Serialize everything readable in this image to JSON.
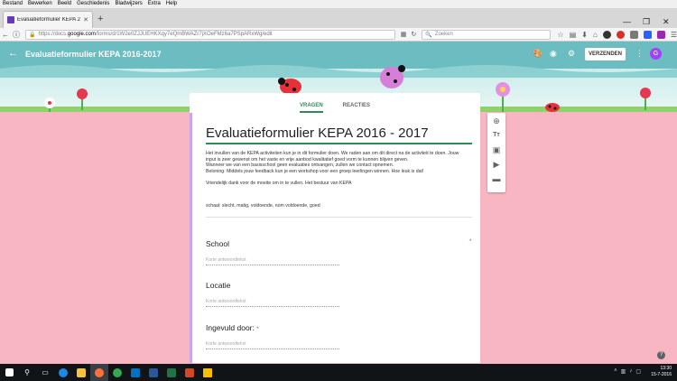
{
  "menubar": [
    "Bestand",
    "Bewerken",
    "Beeld",
    "Geschiedenis",
    "Bladwijzers",
    "Extra",
    "Help"
  ],
  "browser": {
    "tab_title": "Evaluatieformulier KEPA 20...",
    "url_prefix": "https://docs.",
    "url_host": "google.com",
    "url_rest": "/forms/d/1W2e0ZJJUEHKXqy7eQmBWAZr7jXOeFMz6a7PSpARxWg/edit",
    "search_placeholder": "Zoeken"
  },
  "forms_header": {
    "title": "Evaluatieformulier KEPA 2016-2017",
    "send_label": "VERZENDEN",
    "avatar_letter": "G"
  },
  "tabs": {
    "questions": "VRAGEN",
    "responses": "REACTIES"
  },
  "form": {
    "title": "Evaluatieformulier KEPA 2016 - 2017",
    "description": {
      "line1": "Het invullen van de KEPA activiteiten kun je in dit formulier doen. We raden aan om dit direct na de activiteit te doen. Jouw",
      "line2": "input is zeer gewenst om het vaste en vrije aanbod kwalitatief goed vorm te kunnen blijven geven.",
      "line3": "Wanneer we van een basisschool geen evaluaties ontvangen, zullen we contact opnemen.",
      "line4": "Beloning: Middels jouw feedback kun je een workshop voor een groep leerlingen winnen. Hoe leuk is dat!",
      "line5": "Vriendelijk dank voor de moeite om in te vullen. Het bestuur van KEPA"
    },
    "scale": "schaal: slecht, matig, voldoende, ruim voldoende, goed",
    "questions": [
      {
        "label": "School",
        "placeholder": "Korte antwoordtekst",
        "required_mark": ""
      },
      {
        "label": "Locatie",
        "placeholder": "Korte antwoordtekst",
        "required_mark": ""
      },
      {
        "label": "Ingevuld door:",
        "placeholder": "Korte antwoordtekst",
        "required_mark": "*"
      }
    ],
    "top_required_mark": "*"
  },
  "taskbar": {
    "time": "13:30",
    "date": "15-7-2016"
  },
  "colors": {
    "accent_green": "#2e8b57",
    "page_pink": "#f7b6c2",
    "banner_teal": "#6bbdc2",
    "grass": "#8fd16b"
  }
}
